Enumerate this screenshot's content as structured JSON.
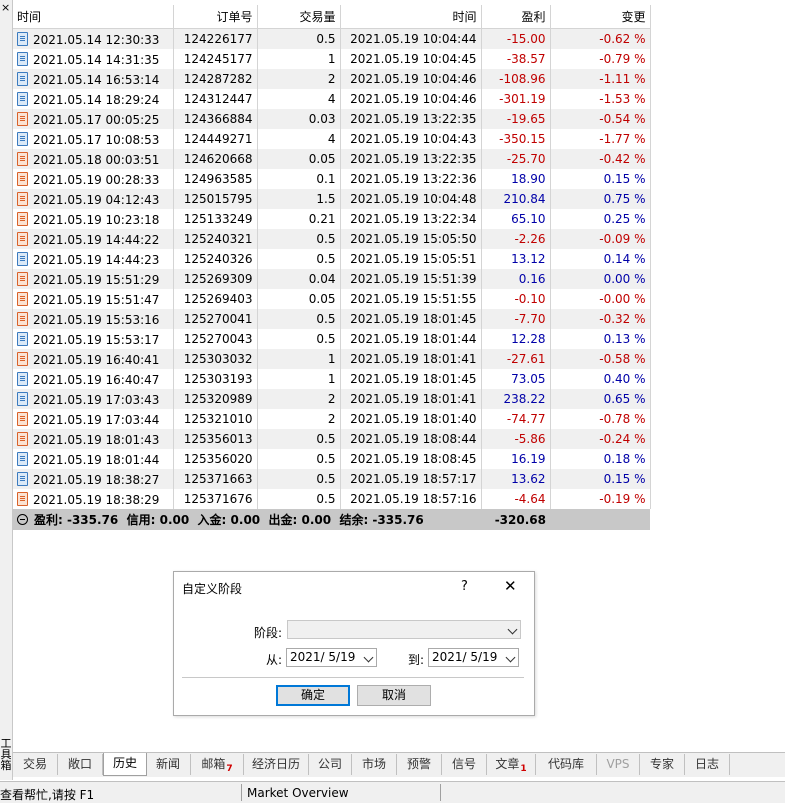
{
  "panel": {
    "close_glyph": "×",
    "vertical_label": "工具箱"
  },
  "columns": {
    "time": "时间",
    "order": "订单号",
    "volume": "交易量",
    "close_time": "时间",
    "profit": "盈利",
    "change": "变更"
  },
  "rows": [
    {
      "type": "buy",
      "time": "2021.05.14 12:30:33",
      "order": "124226177",
      "volume": "0.5",
      "close_time": "2021.05.19 10:04:44",
      "profit": "-15.00",
      "change": "-0.62 %"
    },
    {
      "type": "buy",
      "time": "2021.05.14 14:31:35",
      "order": "124245177",
      "volume": "1",
      "close_time": "2021.05.19 10:04:45",
      "profit": "-38.57",
      "change": "-0.79 %"
    },
    {
      "type": "buy",
      "time": "2021.05.14 16:53:14",
      "order": "124287282",
      "volume": "2",
      "close_time": "2021.05.19 10:04:46",
      "profit": "-108.96",
      "change": "-1.11 %"
    },
    {
      "type": "buy",
      "time": "2021.05.14 18:29:24",
      "order": "124312447",
      "volume": "4",
      "close_time": "2021.05.19 10:04:46",
      "profit": "-301.19",
      "change": "-1.53 %"
    },
    {
      "type": "sell",
      "time": "2021.05.17 00:05:25",
      "order": "124366884",
      "volume": "0.03",
      "close_time": "2021.05.19 13:22:35",
      "profit": "-19.65",
      "change": "-0.54 %"
    },
    {
      "type": "buy",
      "time": "2021.05.17 10:08:53",
      "order": "124449271",
      "volume": "4",
      "close_time": "2021.05.19 10:04:43",
      "profit": "-350.15",
      "change": "-1.77 %"
    },
    {
      "type": "sell",
      "time": "2021.05.18 00:03:51",
      "order": "124620668",
      "volume": "0.05",
      "close_time": "2021.05.19 13:22:35",
      "profit": "-25.70",
      "change": "-0.42 %"
    },
    {
      "type": "sell",
      "time": "2021.05.19 00:28:33",
      "order": "124963585",
      "volume": "0.1",
      "close_time": "2021.05.19 13:22:36",
      "profit": "18.90",
      "change": "0.15 %"
    },
    {
      "type": "sell",
      "time": "2021.05.19 04:12:43",
      "order": "125015795",
      "volume": "1.5",
      "close_time": "2021.05.19 10:04:48",
      "profit": "210.84",
      "change": "0.75 %"
    },
    {
      "type": "sell",
      "time": "2021.05.19 10:23:18",
      "order": "125133249",
      "volume": "0.21",
      "close_time": "2021.05.19 13:22:34",
      "profit": "65.10",
      "change": "0.25 %"
    },
    {
      "type": "sell",
      "time": "2021.05.19 14:44:22",
      "order": "125240321",
      "volume": "0.5",
      "close_time": "2021.05.19 15:05:50",
      "profit": "-2.26",
      "change": "-0.09 %"
    },
    {
      "type": "buy",
      "time": "2021.05.19 14:44:23",
      "order": "125240326",
      "volume": "0.5",
      "close_time": "2021.05.19 15:05:51",
      "profit": "13.12",
      "change": "0.14 %"
    },
    {
      "type": "sell",
      "time": "2021.05.19 15:51:29",
      "order": "125269309",
      "volume": "0.04",
      "close_time": "2021.05.19 15:51:39",
      "profit": "0.16",
      "change": "0.00 %"
    },
    {
      "type": "sell",
      "time": "2021.05.19 15:51:47",
      "order": "125269403",
      "volume": "0.05",
      "close_time": "2021.05.19 15:51:55",
      "profit": "-0.10",
      "change": "-0.00 %"
    },
    {
      "type": "sell",
      "time": "2021.05.19 15:53:16",
      "order": "125270041",
      "volume": "0.5",
      "close_time": "2021.05.19 18:01:45",
      "profit": "-7.70",
      "change": "-0.32 %"
    },
    {
      "type": "buy",
      "time": "2021.05.19 15:53:17",
      "order": "125270043",
      "volume": "0.5",
      "close_time": "2021.05.19 18:01:44",
      "profit": "12.28",
      "change": "0.13 %"
    },
    {
      "type": "sell",
      "time": "2021.05.19 16:40:41",
      "order": "125303032",
      "volume": "1",
      "close_time": "2021.05.19 18:01:41",
      "profit": "-27.61",
      "change": "-0.58 %"
    },
    {
      "type": "buy",
      "time": "2021.05.19 16:40:47",
      "order": "125303193",
      "volume": "1",
      "close_time": "2021.05.19 18:01:45",
      "profit": "73.05",
      "change": "0.40 %"
    },
    {
      "type": "buy",
      "time": "2021.05.19 17:03:43",
      "order": "125320989",
      "volume": "2",
      "close_time": "2021.05.19 18:01:41",
      "profit": "238.22",
      "change": "0.65 %"
    },
    {
      "type": "sell",
      "time": "2021.05.19 17:03:44",
      "order": "125321010",
      "volume": "2",
      "close_time": "2021.05.19 18:01:40",
      "profit": "-74.77",
      "change": "-0.78 %"
    },
    {
      "type": "sell",
      "time": "2021.05.19 18:01:43",
      "order": "125356013",
      "volume": "0.5",
      "close_time": "2021.05.19 18:08:44",
      "profit": "-5.86",
      "change": "-0.24 %"
    },
    {
      "type": "buy",
      "time": "2021.05.19 18:01:44",
      "order": "125356020",
      "volume": "0.5",
      "close_time": "2021.05.19 18:08:45",
      "profit": "16.19",
      "change": "0.18 %"
    },
    {
      "type": "buy",
      "time": "2021.05.19 18:38:27",
      "order": "125371663",
      "volume": "0.5",
      "close_time": "2021.05.19 18:57:17",
      "profit": "13.62",
      "change": "0.15 %"
    },
    {
      "type": "sell",
      "time": "2021.05.19 18:38:29",
      "order": "125371676",
      "volume": "0.5",
      "close_time": "2021.05.19 18:57:16",
      "profit": "-4.64",
      "change": "-0.19 %"
    }
  ],
  "summary": {
    "text": "盈利: -335.76  信用: 0.00  入金: 0.00  出金: 0.00  结余: -335.76",
    "total": "-320.68"
  },
  "dialog": {
    "title": "自定义阶段",
    "help": "?",
    "close": "✕",
    "period_label": "阶段:",
    "period_value": "",
    "from_label": "从:",
    "from_value": "2021/ 5/19",
    "to_label": "到:",
    "to_value": "2021/ 5/19",
    "ok": "确定",
    "cancel": "取消"
  },
  "tabs": [
    {
      "label": "交易"
    },
    {
      "label": "敞口"
    },
    {
      "label": "历史",
      "active": true
    },
    {
      "label": "新闻"
    },
    {
      "label": "邮箱",
      "badge": "7"
    },
    {
      "label": "经济日历"
    },
    {
      "label": "公司"
    },
    {
      "label": "市场"
    },
    {
      "label": "预警"
    },
    {
      "label": "信号"
    },
    {
      "label": "文章",
      "badge": "1"
    },
    {
      "label": "代码库"
    },
    {
      "label": "VPS",
      "dim": true
    },
    {
      "label": "专家"
    },
    {
      "label": "日志"
    }
  ],
  "status": {
    "help": "查看帮忙,请按 F1",
    "market": "Market Overview"
  },
  "colors": {
    "negative": "#c00000",
    "positive": "#0000a8",
    "accent": "#0078d7"
  }
}
